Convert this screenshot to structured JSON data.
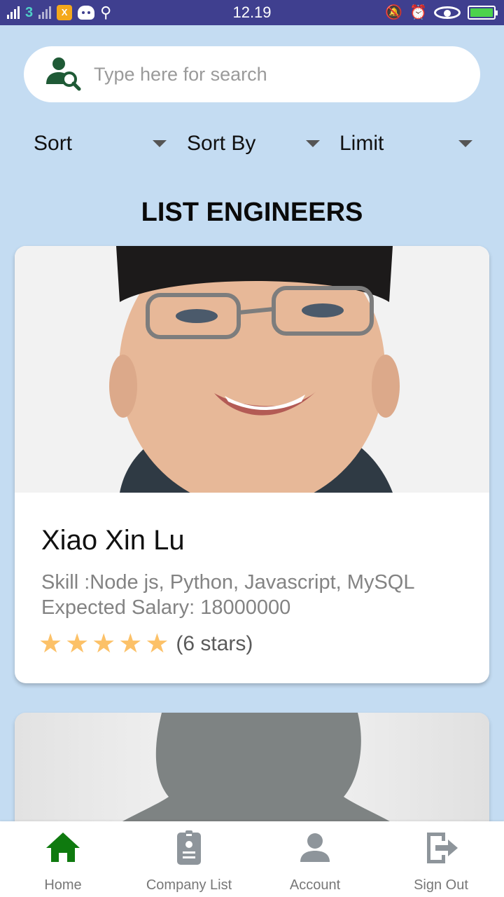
{
  "status_bar": {
    "time": "12.19",
    "network": "3",
    "app_badge": "X",
    "battery_color": "#4cd34c"
  },
  "search": {
    "placeholder": "Type here for search",
    "icon": "user-search-icon"
  },
  "filters": [
    {
      "label": "Sort"
    },
    {
      "label": "Sort By"
    },
    {
      "label": "Limit"
    }
  ],
  "page_title": "LIST ENGINEERS",
  "engineers": [
    {
      "name": "Xiao Xin Lu",
      "skill": "Skill :Node js, Python, Javascript, MySQL",
      "salary": "Expected Salary: 18000000",
      "stars_shown": 5,
      "stars_text": "(6 stars)"
    }
  ],
  "bottom_nav": {
    "items": [
      {
        "label": "Home",
        "icon": "home-icon",
        "active": true
      },
      {
        "label": "Company List",
        "icon": "company-badge-icon",
        "active": false
      },
      {
        "label": "Account",
        "icon": "account-icon",
        "active": false
      },
      {
        "label": "Sign Out",
        "icon": "sign-out-icon",
        "active": false
      }
    ],
    "active_color": "#0f7a0f",
    "inactive_color": "#8e959b"
  },
  "colors": {
    "background": "#c4dcf2",
    "status_bar": "#3f3f8f",
    "star": "#fcc168",
    "icon_green": "#1f5a36"
  }
}
